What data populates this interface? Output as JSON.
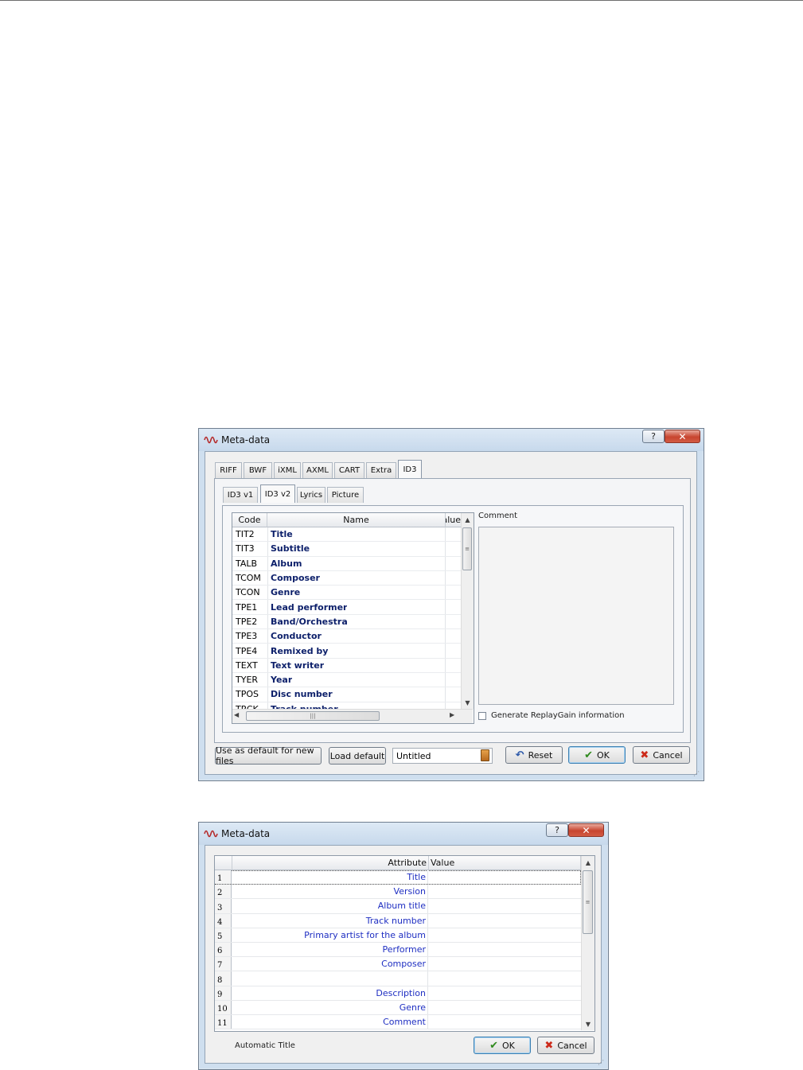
{
  "dialog1": {
    "title": "Meta-data",
    "help": "?",
    "close": "✕",
    "tabs": [
      "RIFF",
      "BWF",
      "iXML",
      "AXML",
      "CART",
      "Extra",
      "ID3"
    ],
    "subtabs": [
      "ID3 v1",
      "ID3 v2",
      "Lyrics",
      "Picture"
    ],
    "columns": {
      "code": "Code",
      "name": "Name",
      "value": "Value"
    },
    "rows": [
      {
        "code": "TIT2",
        "name": "Title"
      },
      {
        "code": "TIT3",
        "name": "Subtitle"
      },
      {
        "code": "TALB",
        "name": "Album"
      },
      {
        "code": "TCOM",
        "name": "Composer"
      },
      {
        "code": "TCON",
        "name": "Genre"
      },
      {
        "code": "TPE1",
        "name": "Lead performer"
      },
      {
        "code": "TPE2",
        "name": "Band/Orchestra"
      },
      {
        "code": "TPE3",
        "name": "Conductor"
      },
      {
        "code": "TPE4",
        "name": "Remixed by"
      },
      {
        "code": "TEXT",
        "name": "Text writer"
      },
      {
        "code": "TYER",
        "name": "Year"
      },
      {
        "code": "TPOS",
        "name": "Disc number"
      },
      {
        "code": "TRCK",
        "name": "Track number"
      }
    ],
    "comment_label": "Comment",
    "replaygain_label": "Generate ReplayGain information",
    "use_default_btn": "Use as default for new files",
    "load_default_btn": "Load default",
    "preset_value": "Untitled",
    "reset_btn": "Reset",
    "ok_btn": "OK",
    "cancel_btn": "Cancel"
  },
  "dialog2": {
    "title": "Meta-data",
    "help": "?",
    "close": "✕",
    "columns": {
      "attribute": "Attribute",
      "value": "Value"
    },
    "rows": [
      {
        "n": "1",
        "attr": "Title"
      },
      {
        "n": "2",
        "attr": "Version"
      },
      {
        "n": "3",
        "attr": "Album title"
      },
      {
        "n": "4",
        "attr": "Track number"
      },
      {
        "n": "5",
        "attr": "Primary artist for the album"
      },
      {
        "n": "6",
        "attr": "Performer"
      },
      {
        "n": "7",
        "attr": "Composer"
      },
      {
        "n": "8",
        "attr": ""
      },
      {
        "n": "9",
        "attr": "Description"
      },
      {
        "n": "10",
        "attr": "Genre"
      },
      {
        "n": "11",
        "attr": "Comment"
      }
    ],
    "auto_title_label": "Automatic Title",
    "ok_btn": "OK",
    "cancel_btn": "Cancel"
  },
  "colors": {
    "accent_blue": "#1f2fc2",
    "name_navy": "#0c1f6a",
    "titlebar": "#cfdfef"
  },
  "icons": [
    "waveform-icon",
    "help-icon",
    "close-icon",
    "reset-icon",
    "check-icon",
    "cancel-icon",
    "preset-folder-icon"
  ]
}
